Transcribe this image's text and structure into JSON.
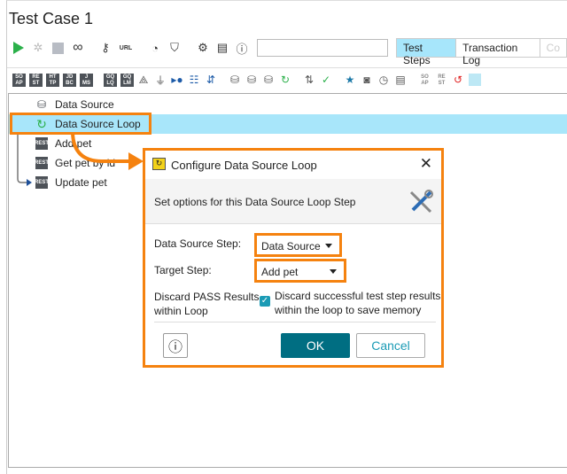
{
  "window": {
    "title": "Test Case 1"
  },
  "toolbar": {
    "icons": [
      "play-icon",
      "debug-icon",
      "stop-icon",
      "loop-icon",
      "key-icon",
      "url-icon",
      "gauge-icon",
      "shield-icon",
      "gear-icon",
      "document-icon",
      "info-icon"
    ],
    "url_label": "URL",
    "search_value": "",
    "tabs": [
      {
        "label": "Test Steps",
        "active": true
      },
      {
        "label": "Transaction Log",
        "active": false
      },
      {
        "label": "Co",
        "active": false
      }
    ]
  },
  "step_toolbar": {
    "text_icons": [
      [
        "SO",
        "AP"
      ],
      [
        "RE",
        "ST"
      ],
      [
        "HT",
        "TP"
      ],
      [
        "JD",
        "BC"
      ],
      [
        "J",
        "MS"
      ],
      [
        "GQ",
        "LQ"
      ],
      [
        "GQ",
        "LM"
      ]
    ],
    "trailing_text_icons": [
      [
        "SO",
        "AP"
      ],
      [
        "RE",
        "ST"
      ]
    ]
  },
  "tree": {
    "items": [
      {
        "label": "Data Source",
        "icon": "data-source-icon",
        "selected": false
      },
      {
        "label": "Data Source Loop",
        "icon": "data-source-loop-icon",
        "selected": true
      },
      {
        "label": "Add pet",
        "icon": "rest-icon",
        "selected": false
      },
      {
        "label": "Get pet by id",
        "icon": "rest-icon",
        "selected": false
      },
      {
        "label": "Update pet",
        "icon": "rest-icon",
        "selected": false
      }
    ],
    "rest_icon": [
      "RE",
      "ST"
    ]
  },
  "dialog": {
    "title": "Configure Data Source Loop",
    "description": "Set options for this Data Source Loop Step",
    "data_source_step_label": "Data Source Step:",
    "data_source_step_value": "Data Source",
    "target_step_label": "Target Step:",
    "target_step_value": "Add pet",
    "discard_label_1": "Discard PASS Results",
    "discard_label_2": "within Loop",
    "discard_checked": true,
    "discard_text_1": "Discard successful test step results",
    "discard_text_2": "within the loop to save memory",
    "ok_label": "OK",
    "cancel_label": "Cancel",
    "accent": "#006e82",
    "highlight": "#f5820f"
  }
}
